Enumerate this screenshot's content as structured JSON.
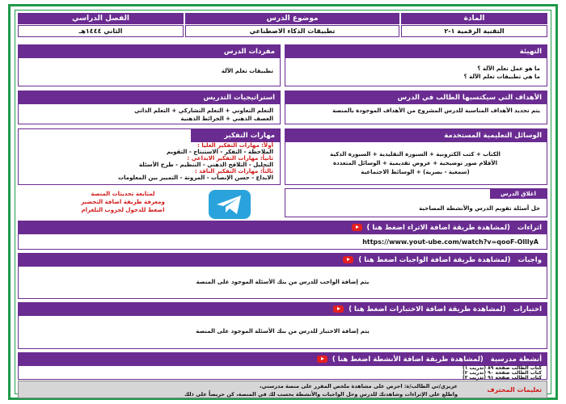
{
  "header": {
    "col_subject_label": "المادة",
    "col_topic_label": "موضوع الدرس",
    "col_term_label": "الفصل الدراسي",
    "subject": "التقنية الرقمية ١-٢",
    "topic": "تطبيقات الذكاء الاصطناعي",
    "term": "الثاني ١٤٤٤هـ"
  },
  "intro": {
    "title": "التهيئة",
    "lines": [
      "ما هو عمل تعلم الآلة ؟",
      "ما هي تطبيقات تعلم الآلة ؟"
    ]
  },
  "vocabulary": {
    "title": "مفردات الدرس",
    "text": "تطبيقات تعلم الآلة"
  },
  "objectives": {
    "title": "الأهداف التي سيكتسبها الطالب في الدرس",
    "text": "يتم تحديد الأهداف المناسبة للدرس المشروح من الأهداف الموجودة بالمنصة"
  },
  "strategies": {
    "title": "استراتيجيات التدريس",
    "lines": [
      "التعلم التعاوني + التعلم التشاركي + التعلم الذاتي",
      "العصف الذهني + الخرائط الذهنية"
    ]
  },
  "aids": {
    "title": "الوسائل التعليمية المستخدمة",
    "lines": [
      "الكتاب + كتب الكترونية + السبورة التقليدية + السبورة الذكية",
      "الأقلام   صور توضيحية + عروض تقديمية + الوسائل المتعددة",
      "(سمعية - بصرية) + الوسائط الاجتماعية"
    ]
  },
  "thinking": {
    "title": "مهارات التفكير",
    "lines": [
      "أولاً: مهارات التفكير العليا :",
      "الملاحظة - التفكر - الاستنتاج - التقويم",
      "ثانياً: مهارات التفكير الابداعي :",
      "التحليل - التلاقح الذهني - التنظيم - طرح الأسئلة",
      "ثالثاً: مهارات التفكير الناقد :",
      "الابداع - حسن الإنصات - المرونة - التمييز بين المعلومات"
    ]
  },
  "telegram": {
    "lines": [
      "لمتابعة تحديثات المنصة",
      "ومعرفة طريقة اضافة التحضير",
      "اضغط للدخول لجروب التلغرام"
    ]
  },
  "closing": {
    "title": "اغلاق الدرس",
    "text": "حل أسئلة تقويم الدرس والأنشطة المصاحبة"
  },
  "enrichment": {
    "title": "اثراءات",
    "link_text": "(لمشاهدة طريقة اضافة الاثراء اضغط هنا )",
    "url": "https://www.yout-ube.com/watch?v=qooF-OlllyA"
  },
  "homework": {
    "title": "واجبات",
    "link_text": "(لمشاهدة طريقة اضافة الواجبات اضغط هنا )",
    "text": "يتم إضافة الواجب للدرس من بنك الأسئلة الموجود على المنصة"
  },
  "tests": {
    "title": "اختبارات",
    "link_text": "(لمشاهدة طريقة اضافة الاختبارات اضغط هنا )",
    "text": "يتم إضافة الاختبار للدرس من بنك الأسئلة الموجود على المنصة"
  },
  "activities": {
    "title": "أنشطة مدرسية",
    "link_text": "(لمشاهدة طريقة اضافة الأنشطة اضغط هنا )",
    "items": [
      "كتاب الطالب صفحة ٨٩ (تدريب ١)",
      "كتاب الطالب صفحة ٩٠ (تدريب ٢)",
      "كتاب الطالب صفحة ٩١ (تدريب ٣)"
    ]
  },
  "footer": {
    "label": "تعليمات المحترف",
    "lines": [
      "عزيزي/تي الطالب/ة: احرص على مشاهدة ملخص المقرر على منصة مدرستي،",
      "واطلع على الإثراءات وشاهدتك للدرس وحل الواجبات والأنشطة بحسب لك في المنصة، كن حريصاً على ذلك"
    ]
  },
  "colors": {
    "accent": "#6a2c91",
    "border": "#1f9a4a",
    "link_red": "#d11a1a"
  }
}
